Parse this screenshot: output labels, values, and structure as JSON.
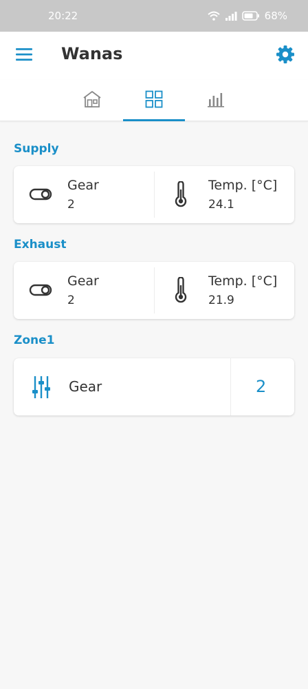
{
  "status_bar": {
    "time": "20:22",
    "battery": "68%"
  },
  "app_bar": {
    "title": "Wanas",
    "menu_icon": "hamburger-menu-icon",
    "settings_icon": "gear-icon"
  },
  "tabs": [
    {
      "icon": "house-icon",
      "active": false
    },
    {
      "icon": "grid-icon",
      "active": true
    },
    {
      "icon": "bar-chart-icon",
      "active": false
    }
  ],
  "colors": {
    "accent": "#1a8fc8",
    "status_bar": "#c8c8c8",
    "background": "#f7f7f7"
  },
  "supply": {
    "title": "Supply",
    "gear_label": "Gear",
    "gear_value": "2",
    "temp_label": "Temp. [°C]",
    "temp_value": "24.1"
  },
  "exhaust": {
    "title": "Exhaust",
    "gear_label": "Gear",
    "gear_value": "2",
    "temp_label": "Temp. [°C]",
    "temp_value": "21.9"
  },
  "zone1": {
    "title": "Zone1",
    "gear_label": "Gear",
    "gear_value": "2"
  }
}
